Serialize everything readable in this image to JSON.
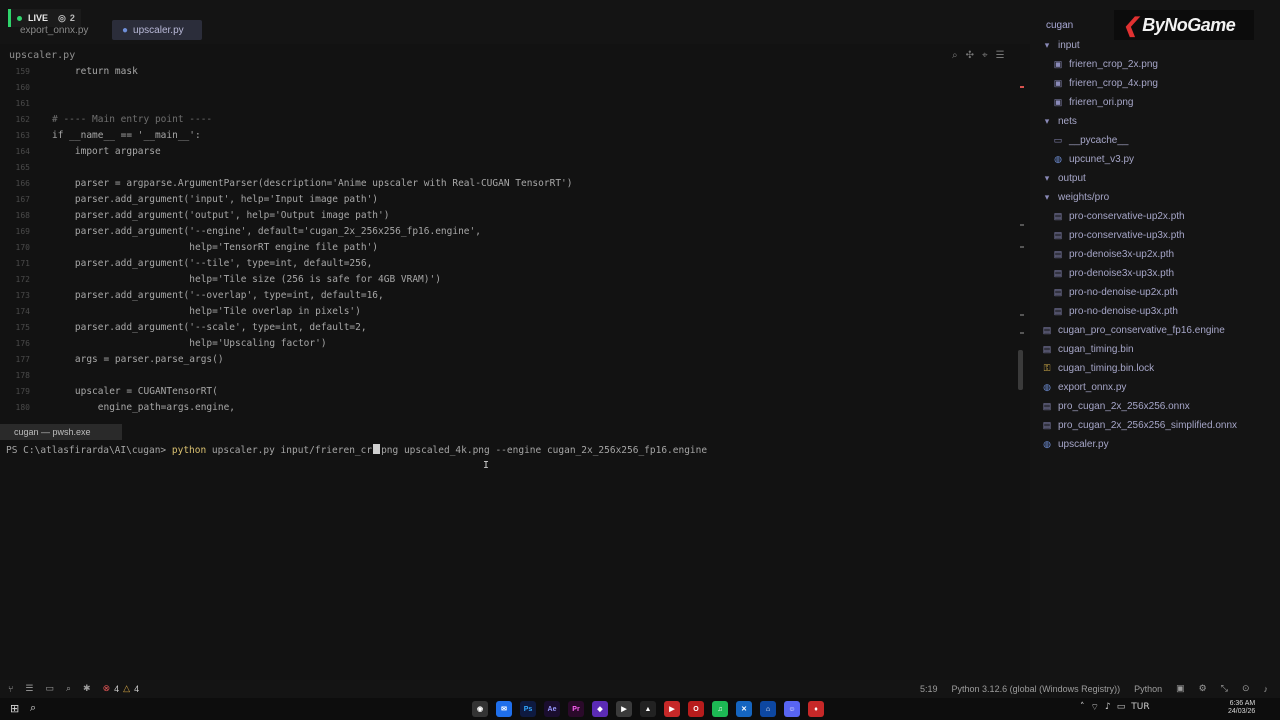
{
  "stream": {
    "live_label": "LIVE",
    "viewer_count": "2"
  },
  "tabs": [
    {
      "label": "export_onnx.py"
    },
    {
      "label": "upscaler.py"
    }
  ],
  "editor": {
    "file_label": "upscaler.py",
    "lines": [
      {
        "n": "159",
        "text": "    return mask"
      },
      {
        "n": "160",
        "text": ""
      },
      {
        "n": "161",
        "text": ""
      },
      {
        "n": "162",
        "text": "# ---- Main entry point ----"
      },
      {
        "n": "163",
        "text": "if __name__ == '__main__':"
      },
      {
        "n": "164",
        "text": "    import argparse"
      },
      {
        "n": "165",
        "text": ""
      },
      {
        "n": "166",
        "text": "    parser = argparse.ArgumentParser(description='Anime upscaler with Real-CUGAN TensorRT')"
      },
      {
        "n": "167",
        "text": "    parser.add_argument('input', help='Input image path')"
      },
      {
        "n": "168",
        "text": "    parser.add_argument('output', help='Output image path')"
      },
      {
        "n": "169",
        "text": "    parser.add_argument('--engine', default='cugan_2x_256x256_fp16.engine',"
      },
      {
        "n": "170",
        "text": "                        help='TensorRT engine file path')"
      },
      {
        "n": "171",
        "text": "    parser.add_argument('--tile', type=int, default=256,"
      },
      {
        "n": "172",
        "text": "                        help='Tile size (256 is safe for 4GB VRAM)')"
      },
      {
        "n": "173",
        "text": "    parser.add_argument('--overlap', type=int, default=16,"
      },
      {
        "n": "174",
        "text": "                        help='Tile overlap in pixels')"
      },
      {
        "n": "175",
        "text": "    parser.add_argument('--scale', type=int, default=2,"
      },
      {
        "n": "176",
        "text": "                        help='Upscaling factor')"
      },
      {
        "n": "177",
        "text": "    args = parser.parse_args()"
      },
      {
        "n": "178",
        "text": ""
      },
      {
        "n": "179",
        "text": "    upscaler = CUGANTensorRT("
      },
      {
        "n": "180",
        "text": "        engine_path=args.engine,"
      }
    ]
  },
  "terminal": {
    "tab_label": "cugan — pwsh.exe",
    "prompt": "PS C:\\atlasfirarda\\AI\\cugan> ",
    "command": "python",
    "args_before_cursor": " upscaler.py input/frieren_cr",
    "args_after_cursor": "png upscaled_4k.png --engine cugan_2x_256x256_fp16.engine"
  },
  "explorer": {
    "root": "cugan",
    "items": [
      {
        "label": "input",
        "icon": "folder-open-icon",
        "indent": 0
      },
      {
        "label": "frieren_crop_2x.png",
        "icon": "image-file-icon",
        "indent": 1
      },
      {
        "label": "frieren_crop_4x.png",
        "icon": "image-file-icon",
        "indent": 1
      },
      {
        "label": "frieren_ori.png",
        "icon": "image-file-icon",
        "indent": 1
      },
      {
        "label": "nets",
        "icon": "folder-open-icon",
        "indent": 0
      },
      {
        "label": "__pycache__",
        "icon": "folder-icon",
        "indent": 1
      },
      {
        "label": "upcunet_v3.py",
        "icon": "python-file-icon",
        "indent": 1
      },
      {
        "label": "output",
        "icon": "folder-open-icon",
        "indent": 0
      },
      {
        "label": "weights/pro",
        "icon": "folder-open-icon",
        "indent": 0
      },
      {
        "label": "pro-conservative-up2x.pth",
        "icon": "file-icon",
        "indent": 1
      },
      {
        "label": "pro-conservative-up3x.pth",
        "icon": "file-icon",
        "indent": 1
      },
      {
        "label": "pro-denoise3x-up2x.pth",
        "icon": "file-icon",
        "indent": 1
      },
      {
        "label": "pro-denoise3x-up3x.pth",
        "icon": "file-icon",
        "indent": 1
      },
      {
        "label": "pro-no-denoise-up2x.pth",
        "icon": "file-icon",
        "indent": 1
      },
      {
        "label": "pro-no-denoise-up3x.pth",
        "icon": "file-icon",
        "indent": 1
      },
      {
        "label": "cugan_pro_conservative_fp16.engine",
        "icon": "file-icon",
        "indent": 0
      },
      {
        "label": "cugan_timing.bin",
        "icon": "file-icon",
        "indent": 0
      },
      {
        "label": "cugan_timing.bin.lock",
        "icon": "lock-icon",
        "indent": 0
      },
      {
        "label": "export_onnx.py",
        "icon": "python-file-icon",
        "indent": 0
      },
      {
        "label": "pro_cugan_2x_256x256.onnx",
        "icon": "file-icon",
        "indent": 0
      },
      {
        "label": "pro_cugan_2x_256x256_simplified.onnx",
        "icon": "file-icon",
        "indent": 0
      },
      {
        "label": "upscaler.py",
        "icon": "python-file-icon",
        "indent": 0
      }
    ]
  },
  "brand": {
    "name": "ByNoGame"
  },
  "statusbar": {
    "errors": "4",
    "warnings": "4",
    "cursor_pos": "5:19",
    "interpreter": "Python 3.12.6 (global (Windows Registry))",
    "language": "Python"
  },
  "taskbar": {
    "time": "6:36 AM",
    "date": "24/03/26",
    "lang": "TUR"
  },
  "colors": {
    "live": "#2fd46b",
    "brand_red": "#e03131",
    "active_tab": "#2b2d3a"
  }
}
